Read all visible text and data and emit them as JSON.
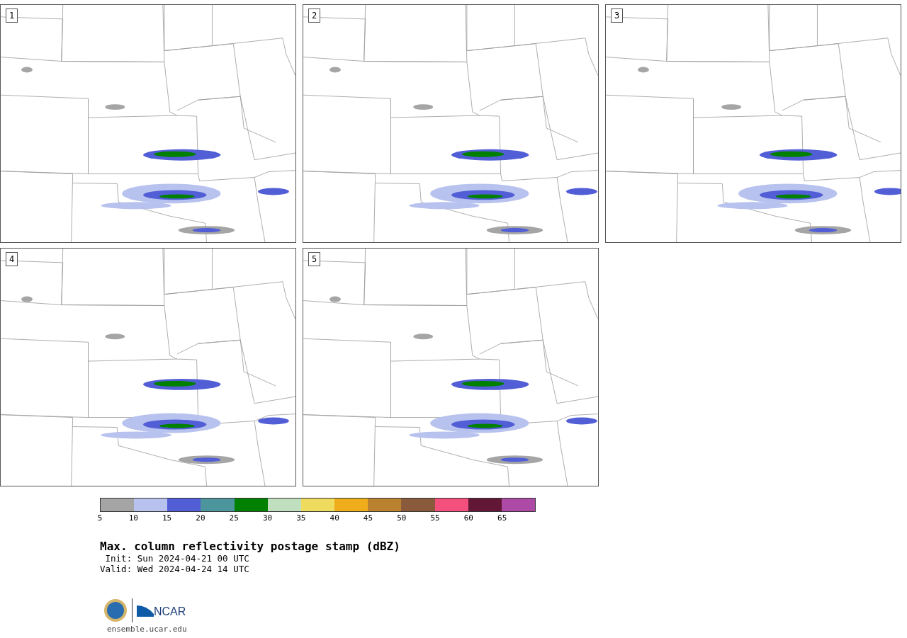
{
  "panels": [
    {
      "label": "1"
    },
    {
      "label": "2"
    },
    {
      "label": "3"
    },
    {
      "label": "4"
    },
    {
      "label": "5"
    }
  ],
  "colorbar": {
    "segments": [
      {
        "color": "#a5a5a5"
      },
      {
        "color": "#b7c2ee"
      },
      {
        "color": "#525ed6"
      },
      {
        "color": "#4d959d"
      },
      {
        "color": "#008000"
      },
      {
        "color": "#bfdfbf"
      },
      {
        "color": "#efdb5e"
      },
      {
        "color": "#efad1b"
      },
      {
        "color": "#ba822e"
      },
      {
        "color": "#8a5a3d"
      },
      {
        "color": "#f4507e"
      },
      {
        "color": "#621737"
      },
      {
        "color": "#ad4aa5"
      }
    ],
    "ticks": [
      "5",
      "10",
      "15",
      "20",
      "25",
      "30",
      "35",
      "40",
      "45",
      "50",
      "55",
      "60",
      "65"
    ]
  },
  "title": "Max. column reflectivity postage stamp (dBZ)",
  "init": " Init: Sun 2024-04-21 00 UTC",
  "valid": "Valid: Wed 2024-04-24 14 UTC",
  "logo_text": "NCAR",
  "url": "ensemble.ucar.edu"
}
